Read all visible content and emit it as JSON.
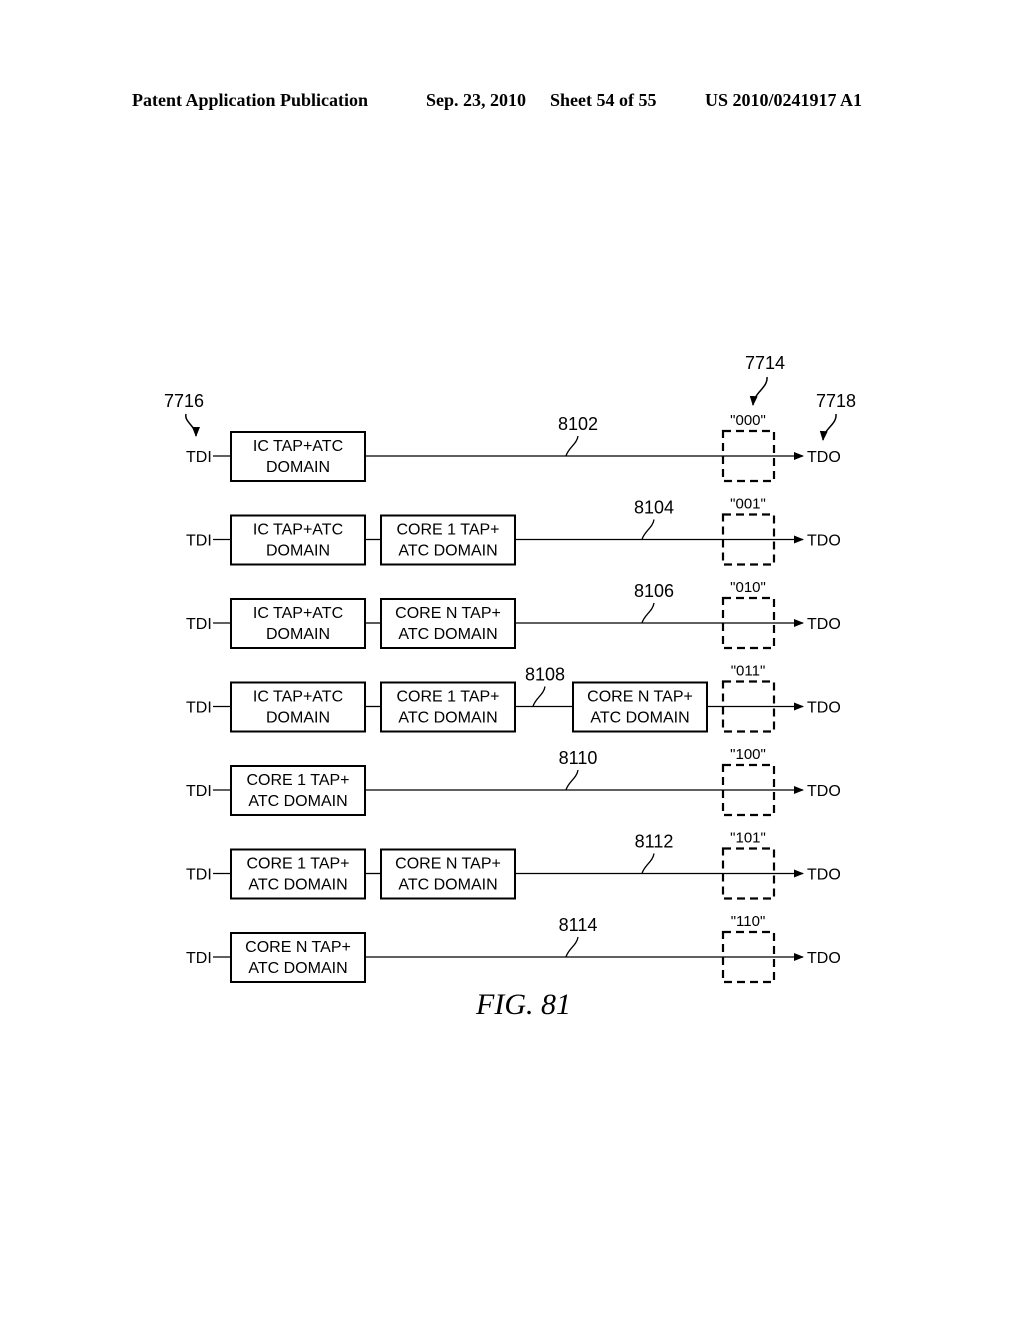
{
  "header": {
    "publication": "Patent Application Publication",
    "date": "Sep. 23, 2010",
    "sheet": "Sheet 54 of 55",
    "number": "US 2010/0241917 A1"
  },
  "figure_label": "FIG. 81",
  "refs": {
    "tdi_ref": "7716",
    "register_ref": "7714",
    "tdo_ref": "7718"
  },
  "input_label": "TDI",
  "output_label": "TDO",
  "rows": [
    {
      "code": "\"000\"",
      "ref": "8102",
      "boxes": [
        [
          "IC TAP+ATC",
          "DOMAIN"
        ]
      ]
    },
    {
      "code": "\"001\"",
      "ref": "8104",
      "boxes": [
        [
          "IC TAP+ATC",
          "DOMAIN"
        ],
        [
          "CORE 1 TAP+",
          "ATC DOMAIN"
        ]
      ]
    },
    {
      "code": "\"010\"",
      "ref": "8106",
      "boxes": [
        [
          "IC TAP+ATC",
          "DOMAIN"
        ],
        [
          "CORE N TAP+",
          "ATC DOMAIN"
        ]
      ]
    },
    {
      "code": "\"011\"",
      "ref": "8108",
      "boxes": [
        [
          "IC TAP+ATC",
          "DOMAIN"
        ],
        [
          "CORE 1 TAP+",
          "ATC DOMAIN"
        ],
        [
          "CORE N TAP+",
          "ATC DOMAIN"
        ]
      ]
    },
    {
      "code": "\"100\"",
      "ref": "8110",
      "boxes": [
        [
          "CORE 1 TAP+",
          "ATC DOMAIN"
        ]
      ]
    },
    {
      "code": "\"101\"",
      "ref": "8112",
      "boxes": [
        [
          "CORE 1 TAP+",
          "ATC DOMAIN"
        ],
        [
          "CORE N TAP+",
          "ATC DOMAIN"
        ]
      ]
    },
    {
      "code": "\"110\"",
      "ref": "8114",
      "boxes": [
        [
          "CORE N TAP+",
          "ATC DOMAIN"
        ]
      ]
    }
  ]
}
